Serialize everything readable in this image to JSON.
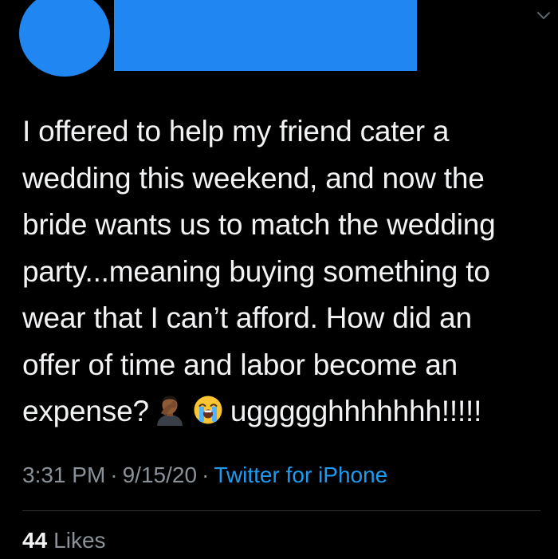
{
  "colors": {
    "background": "#000000",
    "redaction_blue": "#1f86f2",
    "text_primary": "#f2f3f5",
    "text_secondary": "#8a9199",
    "link_blue": "#1d9bf0"
  },
  "header": {
    "avatar_icon": "avatar-redacted",
    "menu_icon": "chevron-down-icon"
  },
  "tweet": {
    "lines": [
      "I offered to help my friend cater a",
      "wedding this weekend, and now the",
      "bride wants us to match the wedding",
      "party...meaning buying something to",
      "wear that I can’t afford. How did an",
      "offer of time and labor become an"
    ],
    "last_line_start": "expense?",
    "emojis": [
      "man-facepalming-emoji",
      "loudly-crying-face-emoji"
    ],
    "last_line_end": "uggggghhhhhhh!!!!!"
  },
  "meta": {
    "time": "3:31 PM",
    "separator": "·",
    "date": "9/15/20",
    "source": "Twitter for iPhone"
  },
  "engagement": {
    "likes_count": "44",
    "likes_label": "Likes"
  }
}
